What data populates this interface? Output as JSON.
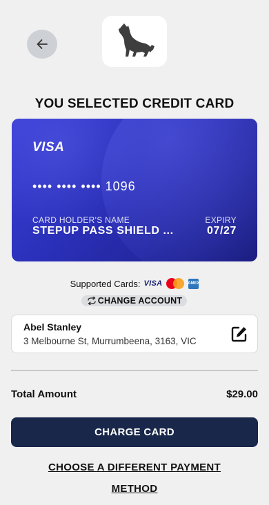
{
  "header": {
    "back_icon": "arrow-left-icon",
    "logo_icon": "wolf-howling-icon"
  },
  "heading": "YOU SELECTED CREDIT CARD",
  "card": {
    "brand": "VISA",
    "number": "•••• •••• •••• 1096",
    "holder_label": "CARD HOLDER'S NAME",
    "holder_name": "STEPUP PASS SHIELD ...",
    "expiry_label": "EXPIRY",
    "expiry_value": "07/27",
    "colors": {
      "gradient_start": "#3b3fd6",
      "gradient_end": "#1a1d7f"
    }
  },
  "supported_cards": {
    "label": "Supported Cards:",
    "visa_text": "VISA",
    "amex_text": "AMEX",
    "icons": [
      "visa-icon",
      "mastercard-icon",
      "amex-icon"
    ]
  },
  "change_account": {
    "label": "CHANGE ACCOUNT",
    "icon": "sync-icon"
  },
  "account": {
    "name": "Abel Stanley",
    "address": "3 Melbourne St, Murrumbeena, 3163, VIC",
    "edit_icon": "edit-icon"
  },
  "total": {
    "label": "Total Amount",
    "value": "$29.00"
  },
  "actions": {
    "charge_label": "CHARGE CARD",
    "different_method_label": "CHOOSE A DIFFERENT PAYMENT METHOD"
  },
  "colors": {
    "background": "#f0f0f0",
    "primary_button": "#18274a",
    "back_button": "#cdd0d4"
  }
}
